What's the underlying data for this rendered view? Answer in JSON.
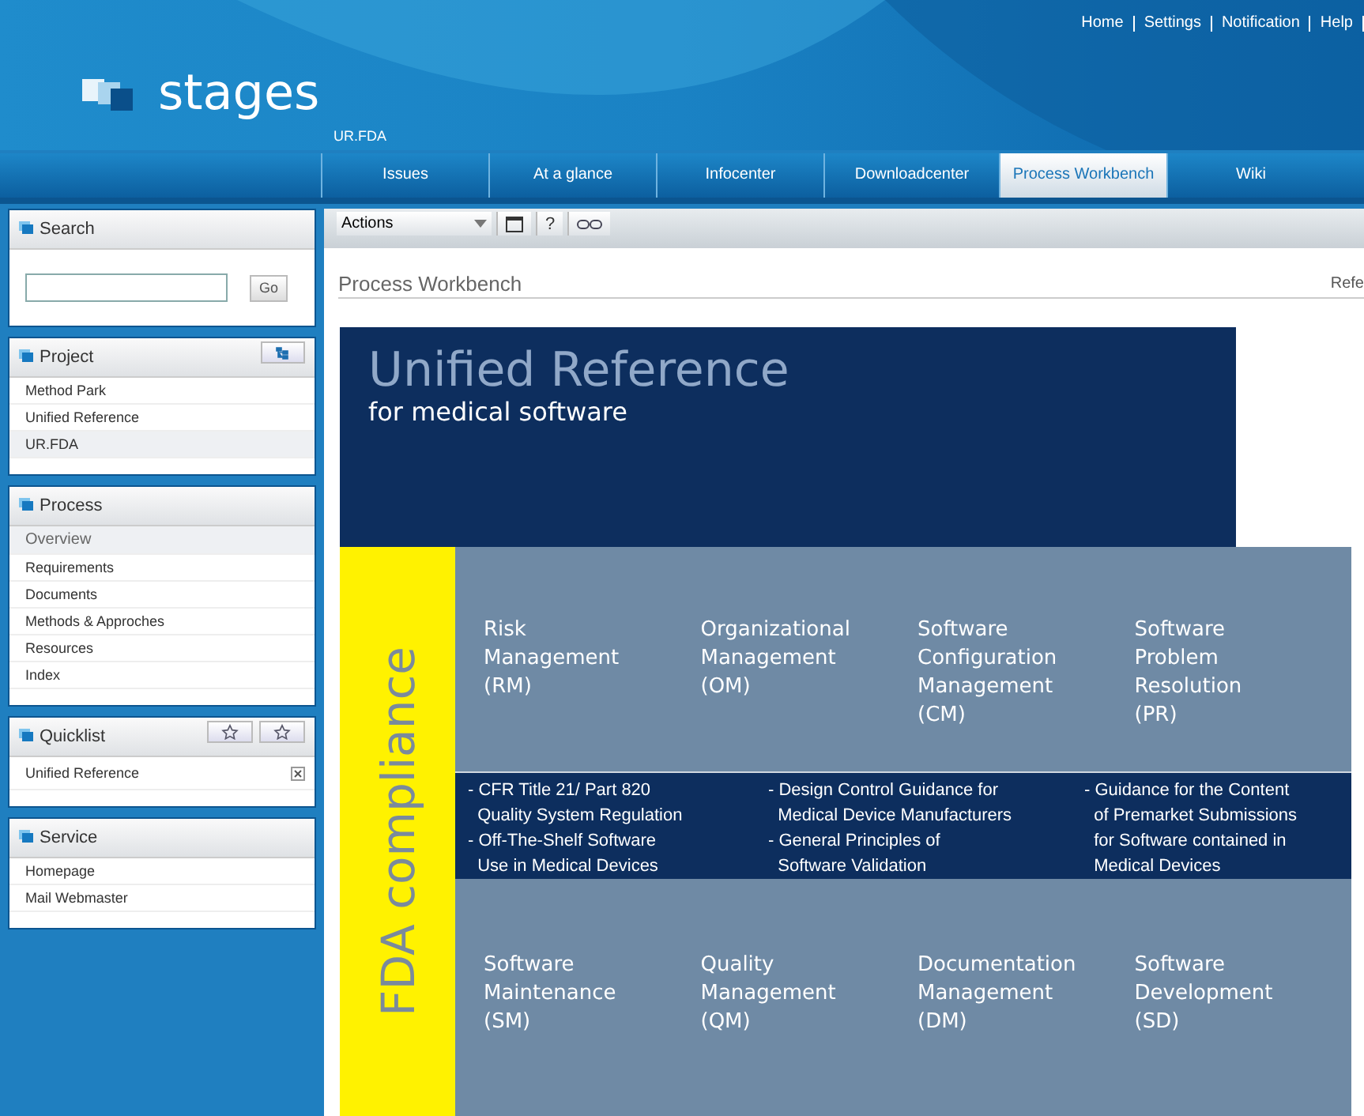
{
  "top_links": [
    "Home",
    "Settings",
    "Notification",
    "Help"
  ],
  "logo": "stages",
  "project_label": "UR.FDA",
  "nav_tabs": [
    {
      "label": "Issues",
      "selected": false
    },
    {
      "label": "At a glance",
      "selected": false
    },
    {
      "label": "Infocenter",
      "selected": false
    },
    {
      "label": "Downloadcenter",
      "selected": false
    },
    {
      "label": "Process Workbench",
      "selected": true
    },
    {
      "label": "Wiki",
      "selected": false
    }
  ],
  "sidebar": {
    "search": {
      "title": "Search",
      "button": "Go"
    },
    "project": {
      "title": "Project",
      "items": [
        {
          "label": "Method Park",
          "selected": false
        },
        {
          "label": "Unified Reference",
          "selected": false
        },
        {
          "label": "UR.FDA",
          "selected": true
        }
      ]
    },
    "process": {
      "title": "Process",
      "items": [
        {
          "label": "Overview",
          "selected": true
        },
        {
          "label": "Requirements",
          "selected": false
        },
        {
          "label": "Documents",
          "selected": false
        },
        {
          "label": "Methods & Approches",
          "selected": false
        },
        {
          "label": "Resources",
          "selected": false
        },
        {
          "label": "Index",
          "selected": false
        }
      ]
    },
    "quicklist": {
      "title": "Quicklist",
      "items": [
        "Unified Reference"
      ]
    },
    "service": {
      "title": "Service",
      "items": [
        "Homepage",
        "Mail Webmaster"
      ]
    }
  },
  "toolbar": {
    "actions": "Actions",
    "help": "?"
  },
  "page_title": "Process Workbench",
  "page_right": "Refe",
  "diagram": {
    "title": "Unified Reference",
    "subtitle": "for medical software",
    "side_label": "FDA compliance",
    "top_areas": [
      "Risk\nManagement\n(RM)",
      "Organizational\nManagement\n(OM)",
      "Software\nConfiguration\nManagement\n(CM)",
      "Software\nProblem\nResolution\n(PR)"
    ],
    "guidance": [
      [
        "- CFR Title 21/ Part 820\n  Quality System Regulation",
        "- Off-The-Shelf Software\n  Use in Medical Devices"
      ],
      [
        "- Design Control Guidance for\n  Medical Device Manufacturers",
        "- General Principles of\n  Software Validation"
      ],
      [
        "- Guidance for the Content\n  of Premarket Submissions\n  for Software contained in\n  Medical Devices"
      ]
    ],
    "bottom_areas": [
      "Software\nMaintenance\n(SM)",
      "Quality\nManagement\n(QM)",
      "Documentation\nManagement\n(DM)",
      "Software\nDevelopment\n(SD)"
    ]
  }
}
